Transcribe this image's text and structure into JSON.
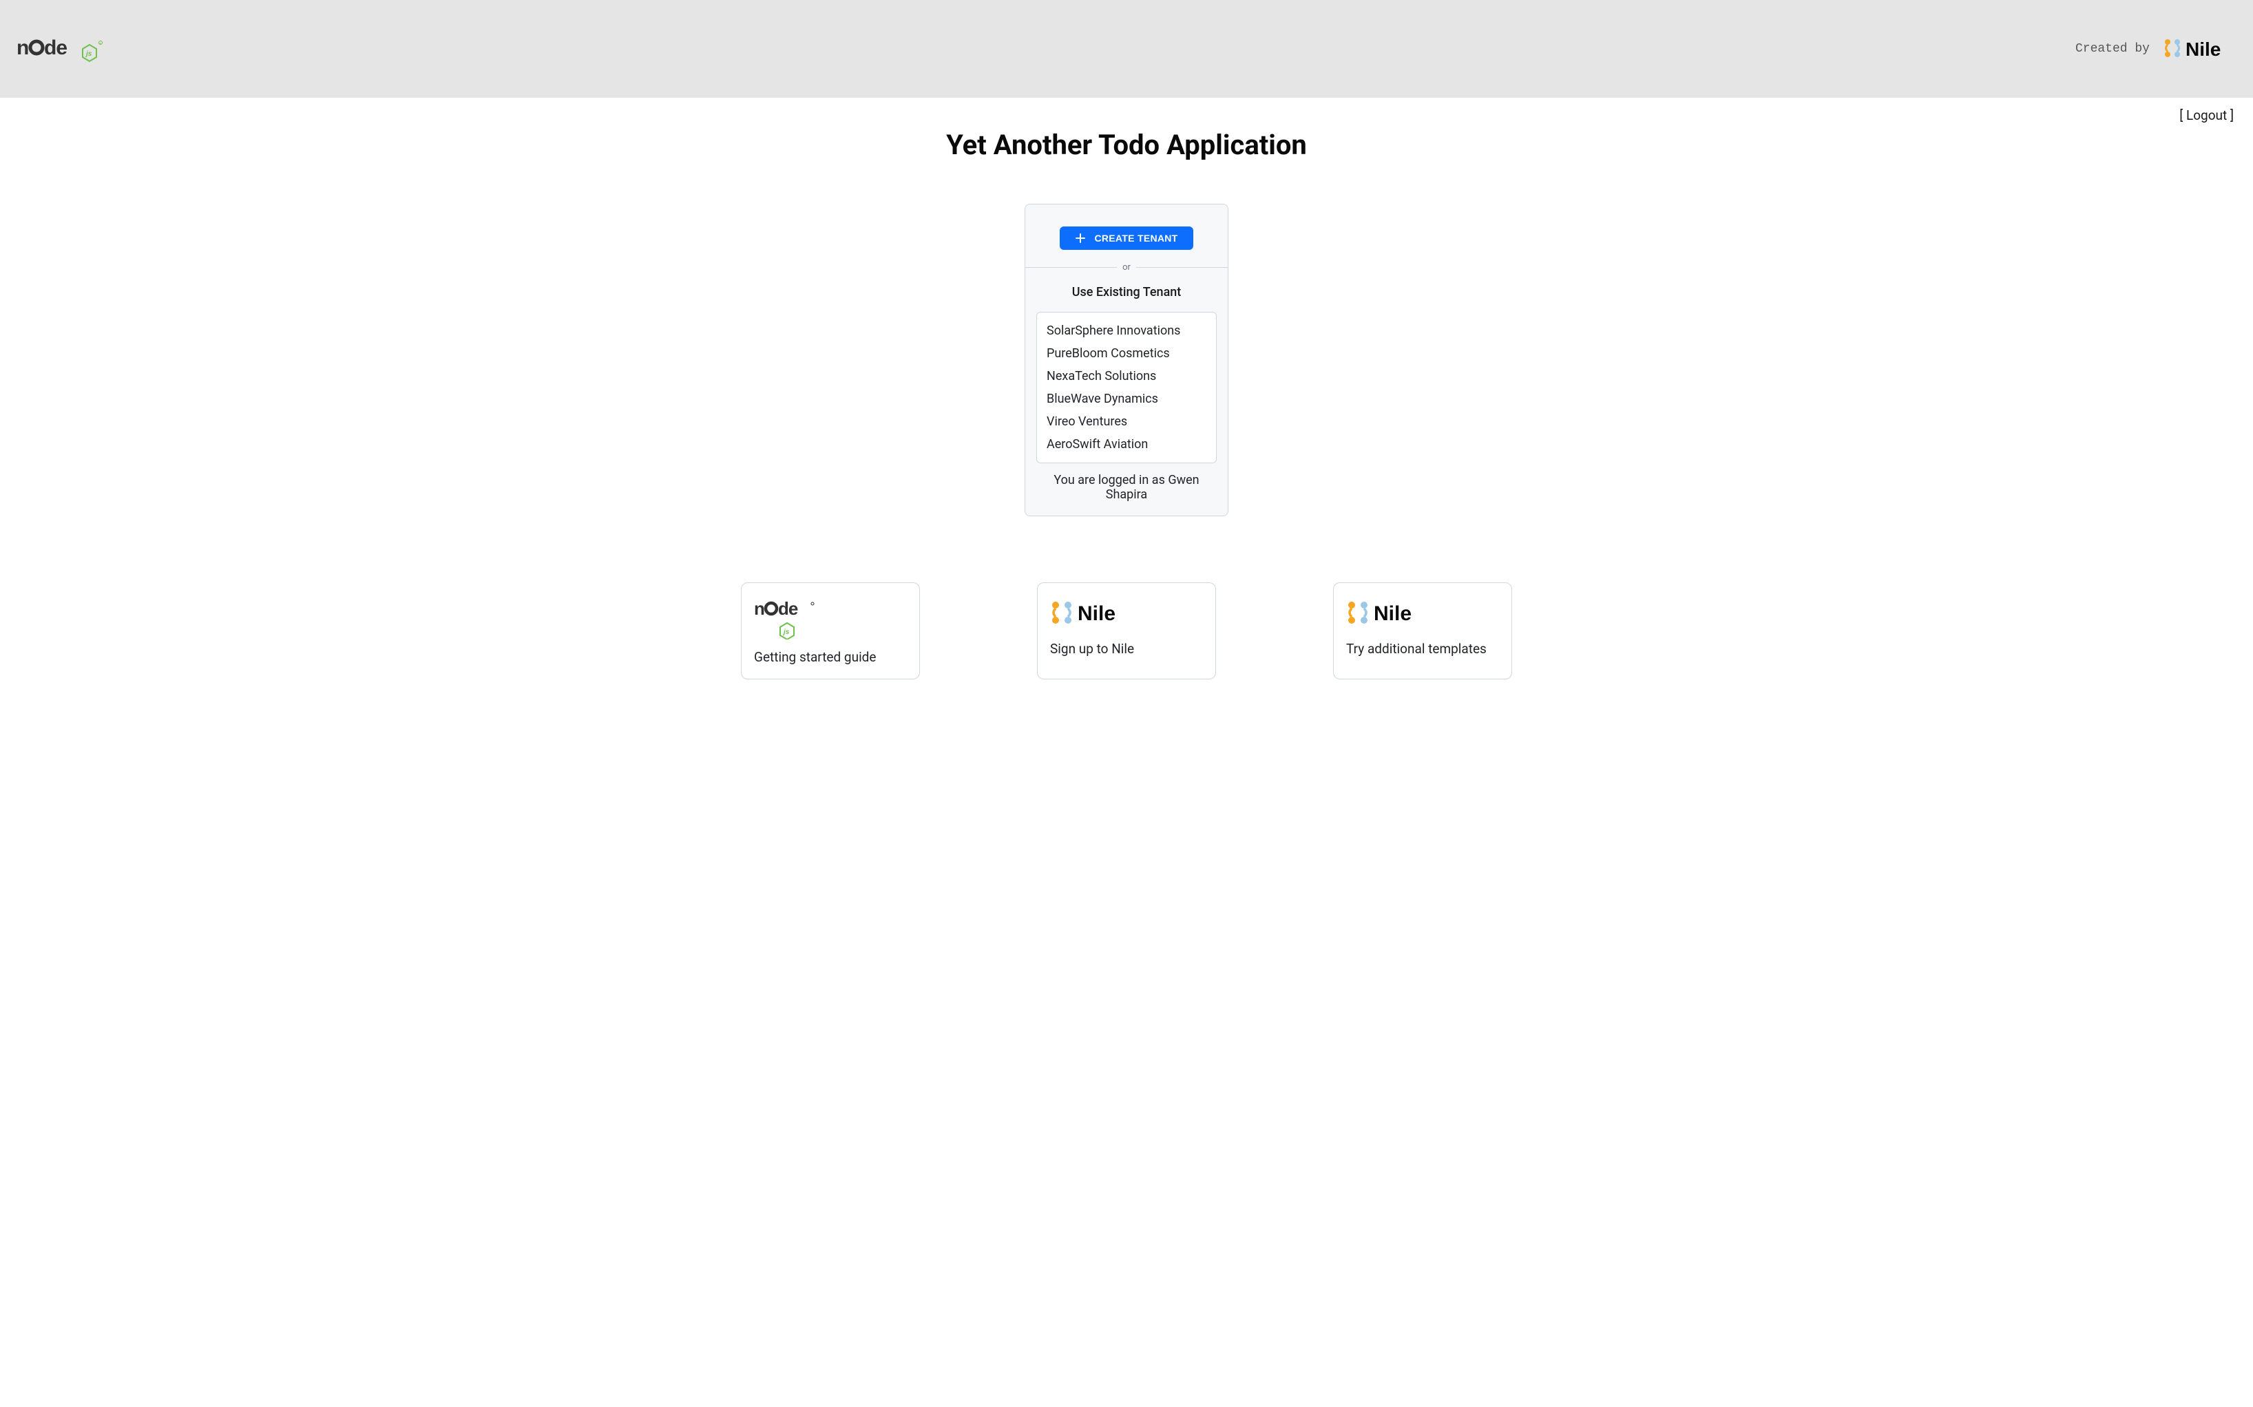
{
  "header": {
    "created_by_label": "Created by",
    "logo_brand": "nodejs",
    "sponsor_brand": "Nile"
  },
  "logout_label": "[ Logout ]",
  "page_title": "Yet Another Todo Application",
  "create_tenant": {
    "button_label": "CREATE TENANT",
    "divider_text": "or"
  },
  "existing": {
    "heading": "Use Existing Tenant",
    "tenants": [
      "SolarSphere Innovations",
      "PureBloom Cosmetics",
      "NexaTech Solutions",
      "BlueWave Dynamics",
      "Vireo Ventures",
      "AeroSwift Aviation"
    ]
  },
  "logged_in_text": "You are logged in as Gwen Shapira",
  "footer_cards": [
    {
      "brand": "nodejs",
      "text": "Getting started guide"
    },
    {
      "brand": "nile",
      "text": "Sign up to Nile"
    },
    {
      "brand": "nile",
      "text": "Try additional templates"
    }
  ]
}
